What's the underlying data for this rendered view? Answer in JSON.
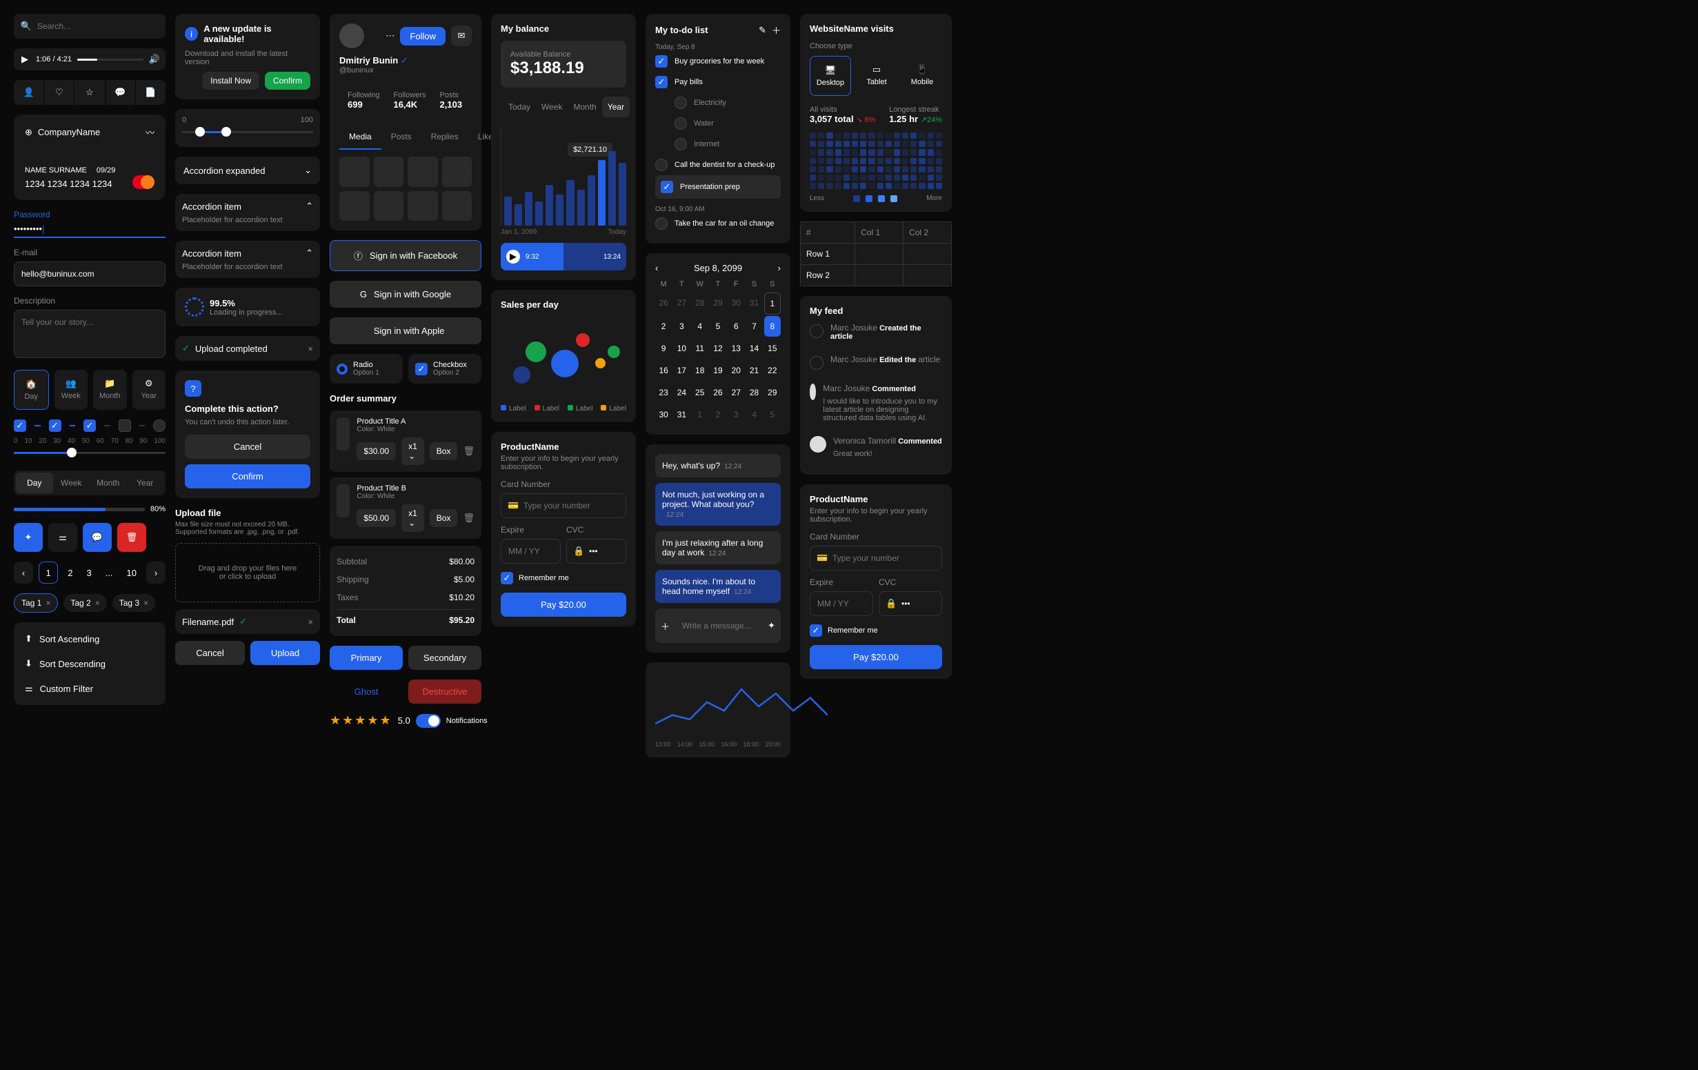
{
  "search": {
    "placeholder": "Search..."
  },
  "player": {
    "time": "1:06 / 4:21"
  },
  "creditCard": {
    "company": "CompanyName",
    "name": "NAME SURNAME",
    "exp": "09/29",
    "number": "1234 1234 1234 1234"
  },
  "password": {
    "label": "Password",
    "value": "•••••••••"
  },
  "email": {
    "label": "E-mail",
    "value": "hello@buninux.com"
  },
  "description": {
    "label": "Description",
    "placeholder": "Tell your our story..."
  },
  "navTabs": {
    "day": "Day",
    "week": "Week",
    "month": "Month",
    "year": "Year"
  },
  "ticks": [
    "0",
    "10",
    "20",
    "30",
    "40",
    "50",
    "60",
    "70",
    "80",
    "90",
    "100"
  ],
  "seg2": {
    "day": "Day",
    "week": "Week",
    "month": "Month",
    "year": "Year"
  },
  "progressPct": "80%",
  "pagination": {
    "p1": "1",
    "p2": "2",
    "p3": "3",
    "dots": "...",
    "p10": "10"
  },
  "tags": {
    "t1": "Tag 1",
    "t2": "Tag 2",
    "t3": "Tag 3"
  },
  "sort": {
    "asc": "Sort Ascending",
    "desc": "Sort Descending",
    "custom": "Custom Filter"
  },
  "alert": {
    "title": "A new update is available!",
    "body": "Download and install the latest version",
    "install": "Install Now",
    "confirm": "Confirm"
  },
  "rangeSlider": {
    "min": "0",
    "max": "100"
  },
  "accordion": {
    "expanded": "Accordion expanded",
    "item": "Accordion item",
    "placeholder": "Placeholder for accordion text"
  },
  "loading": {
    "pct": "99.5%",
    "text": "Loading in progress..."
  },
  "uploadDone": "Upload completed",
  "dialog": {
    "title": "Complete this action?",
    "body": "You can't undo this action later.",
    "cancel": "Cancel",
    "confirm": "Confirm"
  },
  "upload": {
    "title": "Upload file",
    "hint": "Max file size must not exceed 20 MB. Supported formats are .jpg, .png, or .pdf.",
    "drop1": "Drag and drop your files here",
    "drop2": "or click to upload",
    "filename": "Filename.pdf",
    "cancel": "Cancel",
    "upload": "Upload"
  },
  "profile": {
    "name": "Dmitriy Bunin",
    "handle": "@buninux",
    "follow": "Follow"
  },
  "profileStats": {
    "followingL": "Following",
    "following": "699",
    "followersL": "Followers",
    "followers": "16,4K",
    "postsL": "Posts",
    "posts": "2,103"
  },
  "profileTabs": {
    "media": "Media",
    "posts": "Posts",
    "replies": "Replies",
    "likes": "Likes"
  },
  "social": {
    "fb": "Sign in with Facebook",
    "google": "Sign in with Google",
    "apple": "Sign in with Apple"
  },
  "radio": {
    "label": "Radio",
    "opt": "Option 1"
  },
  "checkbox": {
    "label": "Checkbox",
    "opt": "Option 2"
  },
  "order": {
    "title": "Order summary",
    "pA": "Product Title A",
    "pB": "Product Title B",
    "color": "Color: White",
    "priceA": "$30.00",
    "priceB": "$50.00",
    "qty": "x1",
    "box": "Box",
    "subL": "Subtotal",
    "sub": "$80.00",
    "shipL": "Shipping",
    "ship": "$5.00",
    "taxL": "Taxes",
    "tax": "$10.20",
    "totL": "Total",
    "tot": "$95.20"
  },
  "buttons": {
    "primary": "Primary",
    "secondary": "Secondary",
    "ghost": "Ghost",
    "destructive": "Destructive"
  },
  "rating": "5.0",
  "notifications": "Notifications",
  "balance": {
    "title": "My balance",
    "availL": "Available Balance",
    "amount": "$3,188.19",
    "today": "Today",
    "week": "Week",
    "month": "Month",
    "year": "Year",
    "tooltip": "$2,721.10",
    "xStart": "Jan 1, 2099",
    "xEnd": "Today",
    "waveStart": "9:32",
    "waveEnd": "13:24"
  },
  "sales": {
    "title": "Sales per day",
    "legend": "Label"
  },
  "product": {
    "name": "ProductName",
    "hint": "Enter your info to begin your yearly subscription.",
    "cardL": "Card Number",
    "cardPh": "Type your number",
    "expL": "Expire",
    "expPh": "MM / YY",
    "cvcL": "CVC",
    "remember": "Remember me",
    "pay": "Pay $20.00"
  },
  "todo": {
    "title": "My to-do list",
    "date": "Today, Sep 8",
    "t1": "Buy groceries for the week",
    "t2": "Pay bills",
    "t2a": "Electricity",
    "t2b": "Water",
    "t2c": "Internet",
    "t3": "Call the dentist for a check-up",
    "t4": "Presentation prep",
    "sec2": "Oct 16, 9:00 AM",
    "t5": "Take the car for an oil change"
  },
  "calendar": {
    "month": "Sep 8, 2099",
    "days": [
      "M",
      "T",
      "W",
      "T",
      "F",
      "S",
      "S"
    ]
  },
  "chat": {
    "m1": "Hey, what's up?",
    "t1": "12:24",
    "m2": "Not much, just working on a project. What about you?",
    "t2": "12:24",
    "m3": "I'm just relaxing after a long day at work",
    "t3": "12:24",
    "m4": "Sounds nice. I'm about to head home myself",
    "t4": "12:24",
    "input": "Write a message..."
  },
  "visits": {
    "title": "WebsiteName visits",
    "choose": "Choose type",
    "desktop": "Desktop",
    "tablet": "Tablet",
    "mobile": "Mobile",
    "allL": "All visits",
    "all": "3,057 total",
    "allPct": "8%",
    "streakL": "Longest streak",
    "streak": "1.25 hr",
    "streakPct": "24%",
    "less": "Less",
    "more": "More"
  },
  "table": {
    "hash": "#",
    "c1": "Col 1",
    "c2": "Col 2",
    "r1": "Row 1",
    "r2": "Row 2"
  },
  "feed": {
    "title": "My feed",
    "u1": "Marc Josuke",
    "a1": "Created the article",
    "a2": "Edited the",
    "a2b": "article",
    "a3": "Commented",
    "c3": "I would like to introduce you to my latest article on designing structured data tables using AI.",
    "u4": "Veronica Tamorill",
    "a4": "Commented",
    "c4": "Great work!"
  },
  "chart_data": {
    "type": "bar",
    "title": "My balance",
    "ylabel": "",
    "ylim": [
      0,
      4000
    ],
    "yticks": [
      1000,
      1500,
      2000,
      2500,
      3000,
      3500,
      4000
    ],
    "x_range": [
      "Jan 1, 2099",
      "Today"
    ],
    "values": [
      1200,
      900,
      1400,
      1000,
      1700,
      1300,
      1900,
      1500,
      2100,
      2721,
      3100,
      2600
    ],
    "highlight_index": 9,
    "highlight_value": 2721.1
  }
}
